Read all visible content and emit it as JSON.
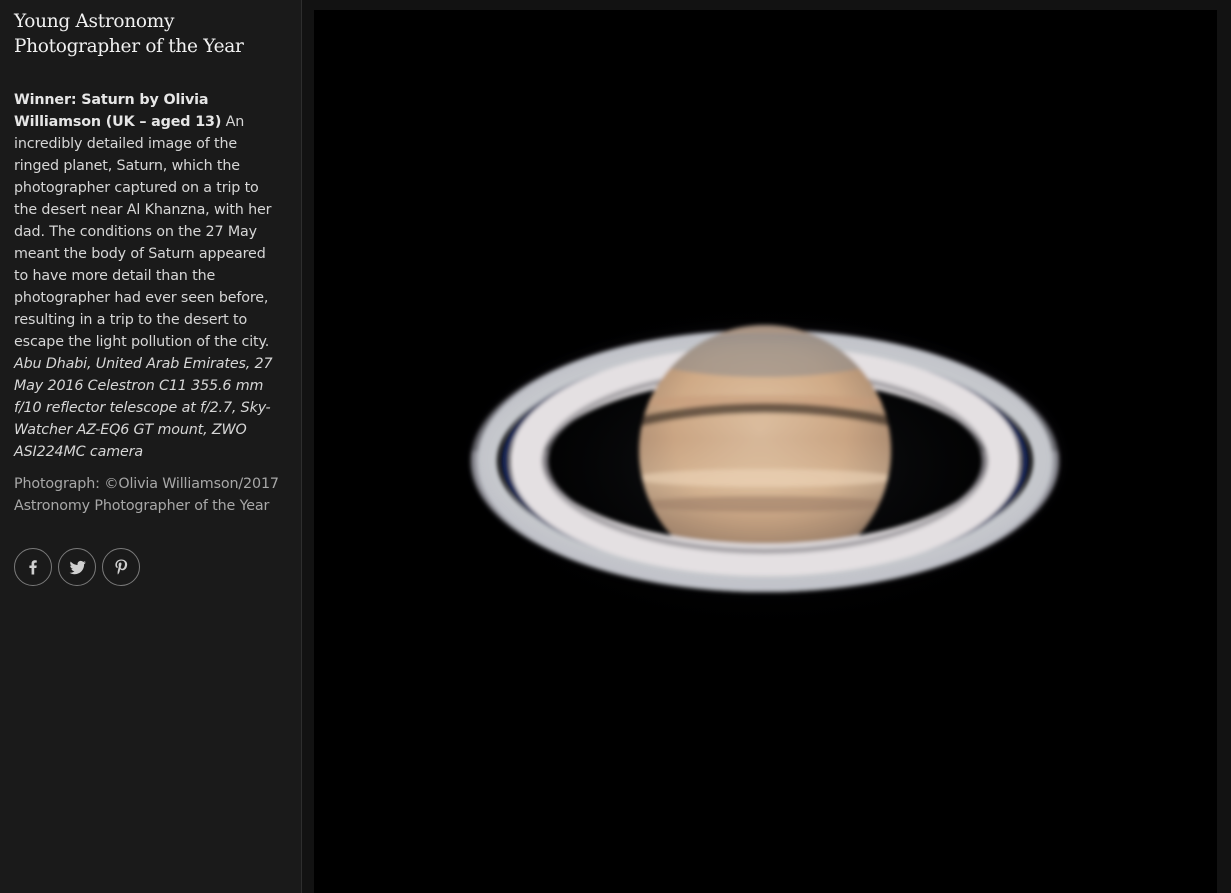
{
  "gallery_title": "Young Astronomy Photographer of the Year",
  "caption": {
    "winner": "Winner: Saturn by Olivia Williamson (UK – aged 13)",
    "description": " An incredibly detailed image of the ringed planet, Saturn, which the photographer captured on a trip to the desert near Al Khanzna, with her dad. The conditions on the 27 May meant the body of Saturn appeared to have more detail than the photographer had ever seen before, resulting in a trip to the desert to escape the light pollution of the city. ",
    "details": "Abu Dhabi, United Arab Emirates, 27 May 2016 Celestron C11 355.6 mm f/10 reflector telescope at f/2.7, Sky-Watcher AZ-EQ6 GT mount, ZWO ASI224MC camera"
  },
  "credit": "Photograph: ©Olivia Williamson/2017 Astronomy Photographer of the Year",
  "share": [
    {
      "icon": "facebook-icon"
    },
    {
      "icon": "twitter-icon"
    },
    {
      "icon": "pinterest-icon"
    }
  ],
  "colors": {
    "sidebar_bg": "#1a1a1a",
    "photo_bg": "#000000",
    "title_text": "#f1f1f1",
    "caption_text": "#d6d6d6",
    "credit_text": "#a8a8a8",
    "share_border": "#7a7a7a"
  }
}
